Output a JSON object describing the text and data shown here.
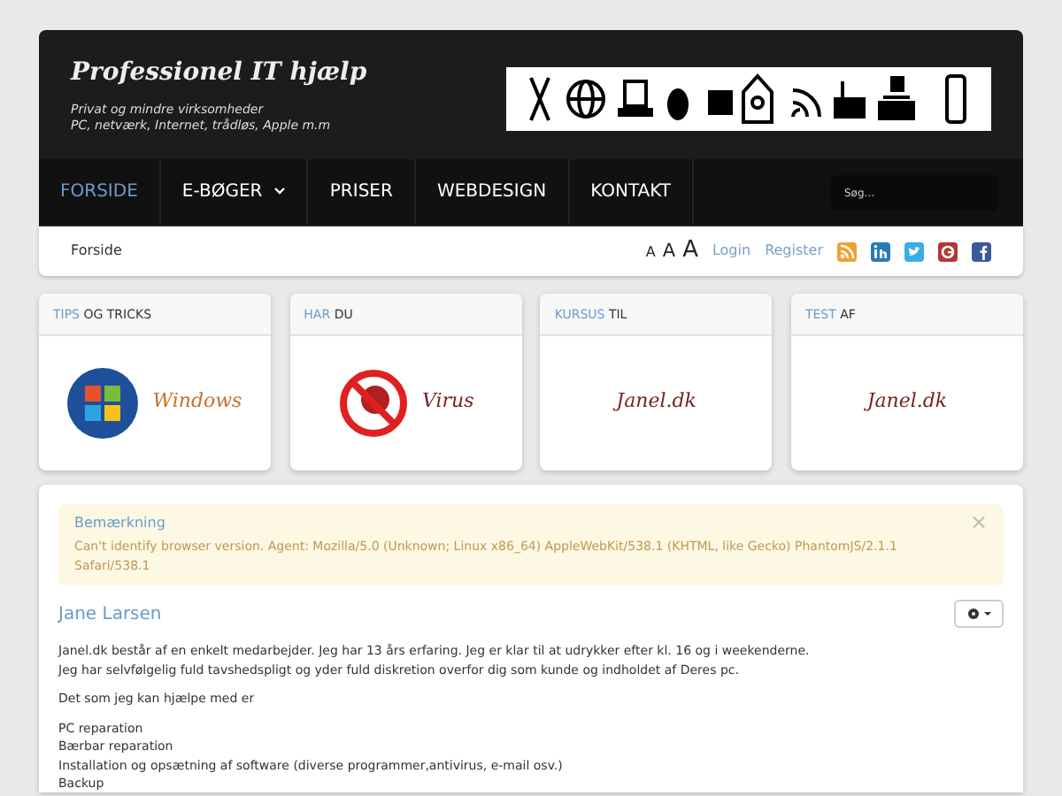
{
  "header": {
    "title": "Professionel IT hjælp",
    "tagline": [
      "Privat og mindre virksomheder",
      "PC, netværk, Internet, trådløs, Apple m.m"
    ]
  },
  "nav": {
    "items": [
      {
        "label": "FORSIDE",
        "selected": true,
        "dropdown": false
      },
      {
        "label": "E-BØGER",
        "selected": false,
        "dropdown": true
      },
      {
        "label": "PRISER",
        "selected": false,
        "dropdown": false
      },
      {
        "label": "WEBDESIGN",
        "selected": false,
        "dropdown": false
      },
      {
        "label": "KONTAKT",
        "selected": false,
        "dropdown": false
      }
    ],
    "search": {
      "placeholder": "Søg..."
    }
  },
  "breadcrumb": "Forside",
  "font_sizes": [
    "A",
    "A",
    "A"
  ],
  "user_links": [
    "Login",
    "Register"
  ],
  "social": [
    {
      "kind": "rss",
      "color": "#f0a030"
    },
    {
      "kind": "linkedin",
      "color": "#2a7ab8"
    },
    {
      "kind": "twitter",
      "color": "#3aaee0"
    },
    {
      "kind": "google",
      "color": "#b03a30"
    },
    {
      "kind": "facebook",
      "color": "#3a5a9a"
    }
  ],
  "modules": [
    {
      "accent": "TIPS",
      "rest": "OG TRICKS",
      "kind": "windows",
      "caption": "Windows"
    },
    {
      "accent": "HAR",
      "rest": "DU",
      "kind": "virus",
      "caption": "Virus"
    },
    {
      "accent": "KURSUS",
      "rest": "TIL",
      "kind": "text",
      "caption": "Janel.dk"
    },
    {
      "accent": "TEST",
      "rest": "AF",
      "kind": "text",
      "caption": "Janel.dk"
    }
  ],
  "alert": {
    "title": "Bemærkning",
    "text": "Can't identify browser version. Agent: Mozilla/5.0 (Unknown; Linux x86_64) AppleWebKit/538.1 (KHTML, like Gecko) PhantomJS/2.1.1 Safari/538.1",
    "close": "×"
  },
  "article": {
    "title": "Jane Larsen",
    "paragraphs": [
      [
        "Janel.dk består af en enkelt medarbejder. Jeg har 13 års erfaring. Jeg er klar til at udrykker efter kl. 16 og i weekenderne.",
        "Jeg har selvfølgelig fuld tavshedspligt og yder fuld diskretion overfor dig som kunde og indholdet af Deres pc."
      ],
      [
        "Det som jeg kan hjælpe med er"
      ],
      [
        "PC reparation",
        "Bærbar reparation",
        "Installation og opsætning af software (diverse programmer,antivirus, e-mail osv.)",
        "Backup"
      ]
    ]
  }
}
